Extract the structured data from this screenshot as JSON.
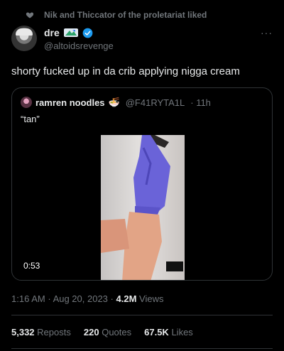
{
  "social_context": {
    "text": "Nik and Thiccator of the proletariat liked",
    "icon": "heart-icon"
  },
  "author": {
    "display_name": "dre",
    "handle": "@altoidsrevenge",
    "verified": true,
    "flag_icon": "flag-emoji-icon"
  },
  "menu": {
    "icon": "more-icon",
    "label": "···"
  },
  "tweet": {
    "text": "shorty fucked up in da crib applying nigga cream"
  },
  "quote": {
    "display_name": "ramren noodles",
    "emoji": "🍜",
    "handle": "@F41RYTA1L",
    "time": "· 11h",
    "text": "“tan”",
    "video": {
      "duration": "0:53"
    }
  },
  "meta": {
    "time": "1:16 AM",
    "date": "Aug 20, 2023",
    "views_count": "4.2M",
    "views_label": "Views"
  },
  "stats": {
    "reposts_count": "5,332",
    "reposts_label": "Reposts",
    "quotes_count": "220",
    "quotes_label": "Quotes",
    "likes_count": "67.5K",
    "likes_label": "Likes"
  },
  "colors": {
    "background": "#000000",
    "text": "#e7e9ea",
    "secondary": "#71767b",
    "verified": "#1d9bf0",
    "border": "#2f3336"
  }
}
